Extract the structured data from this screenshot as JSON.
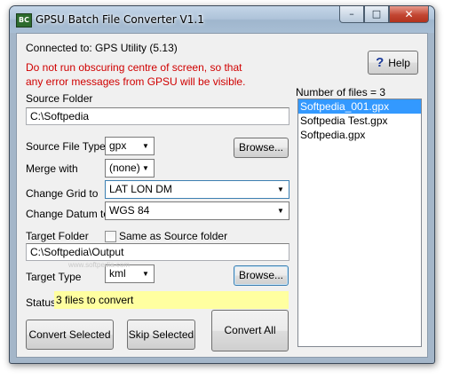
{
  "window": {
    "title": "GPSU Batch File Converter V1.1",
    "app_icon_text": "BC",
    "controls": {
      "minimize": "–",
      "maximize": "□",
      "close": "✕"
    }
  },
  "connection": {
    "label": "Connected to: GPS Utility (5.13)"
  },
  "warning": {
    "line1": "Do not run obscuring centre of screen, so that",
    "line2": "any error messages from GPSU will be visible."
  },
  "help": {
    "label": "Help",
    "icon": "question-icon",
    "glyph": "?"
  },
  "source_folder": {
    "label": "Source Folder",
    "value": "C:\\Softpedia"
  },
  "source_file_type": {
    "label": "Source File Type:",
    "value": "gpx"
  },
  "merge_with": {
    "label": "Merge with",
    "value": "(none)"
  },
  "change_grid": {
    "label": "Change Grid to",
    "value": "LAT LON DM"
  },
  "change_datum": {
    "label": "Change Datum to",
    "value": "WGS 84"
  },
  "target_folder": {
    "label": "Target Folder",
    "value": "C:\\Softpedia\\Output",
    "same_as_source_label": "Same as Source folder",
    "same_as_source_checked": false
  },
  "target_type": {
    "label": "Target Type",
    "value": "kml"
  },
  "browse_label": "Browse...",
  "status": {
    "label": "Status",
    "value": "3 files to convert"
  },
  "files": {
    "count_label": "Number of files = 3",
    "items": [
      "Softpedia_001.gpx",
      "Softpedia Test.gpx",
      "Softpedia.gpx"
    ],
    "selected_index": 0
  },
  "actions": {
    "convert_selected": "Convert Selected",
    "skip_selected": "Skip Selected",
    "convert_all": "Convert All"
  },
  "watermark": "www.softpedia.com",
  "colors": {
    "warning_text": "#d00000",
    "status_background": "#ffffa0",
    "selection_background": "#3399ff",
    "close_button": "#c24632"
  }
}
